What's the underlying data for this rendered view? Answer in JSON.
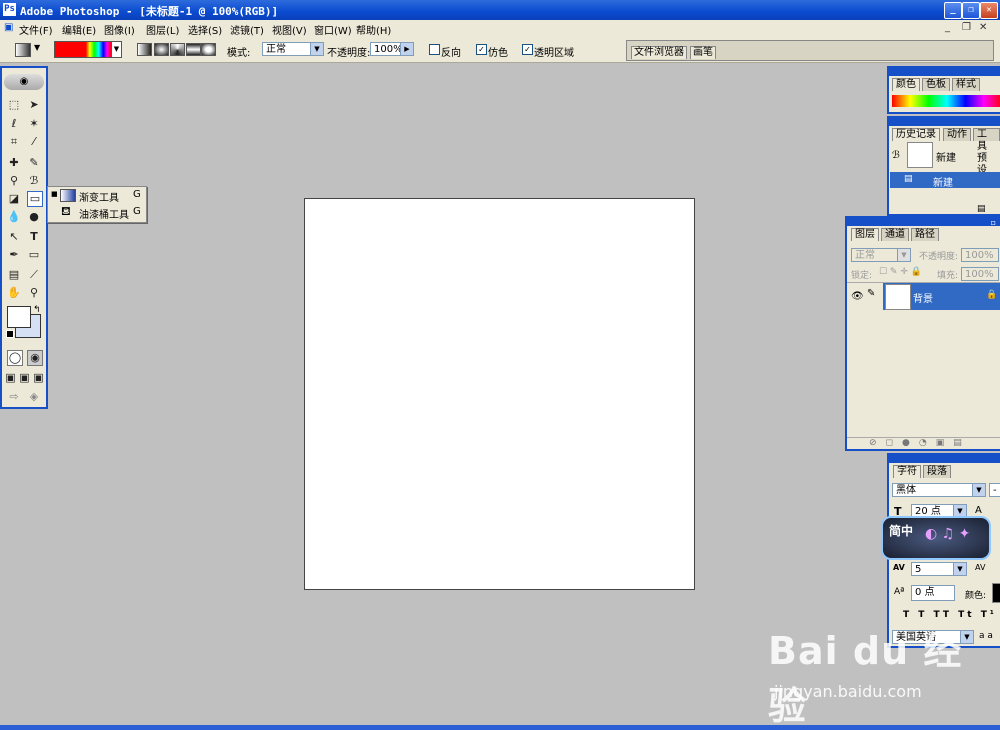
{
  "window": {
    "title": "Adobe Photoshop - [未标题-1 @ 100%(RGB)]"
  },
  "menu": [
    "文件(F)",
    "编辑(E)",
    "图像(I)",
    "图层(L)",
    "选择(S)",
    "滤镜(T)",
    "视图(V)",
    "窗口(W)",
    "帮助(H)"
  ],
  "options": {
    "mode_label": "模式:",
    "mode_value": "正常",
    "opacity_label": "不透明度:",
    "opacity_value": "100%",
    "reverse_label": "反向",
    "dither_label": "仿色",
    "transparency_label": "透明区域",
    "reverse_checked": false,
    "dither_checked": true,
    "transparency_checked": true
  },
  "palette_well": [
    "文件浏览器",
    "画笔"
  ],
  "flyout": [
    {
      "label": "渐变工具",
      "key": "G",
      "selected": true
    },
    {
      "label": "油漆桶工具",
      "key": "G",
      "selected": false
    }
  ],
  "color_panel": {
    "tabs": [
      "颜色",
      "色板",
      "样式"
    ]
  },
  "history_panel": {
    "tabs": [
      "历史记录",
      "动作",
      "工具预设"
    ],
    "snapshot_label": "新建",
    "state_label": "新建"
  },
  "layers_panel": {
    "tabs": [
      "图层",
      "通道",
      "路径"
    ],
    "blend_mode": "正常",
    "opacity_label": "不透明度:",
    "opacity_value": "100%",
    "lock_label": "锁定:",
    "fill_label": "填充:",
    "fill_value": "100%",
    "layer_name": "背景"
  },
  "character_panel": {
    "tabs": [
      "字符",
      "段落"
    ],
    "font_family": "黑体",
    "font_size": "20 点",
    "tracking": "5",
    "baseline": "0 点",
    "color_label": "颜色:",
    "language": "美国英语",
    "aa_label": "a a"
  },
  "ime_badge": {
    "text": "简中"
  },
  "watermark": {
    "logo": "Bai du 经验",
    "url": "jingyan.baidu.com"
  },
  "colors": {
    "titlebar": "#0a4bd0",
    "selection": "#316ac5",
    "workspace": "#c0c0c0",
    "chrome": "#ece9d8"
  }
}
